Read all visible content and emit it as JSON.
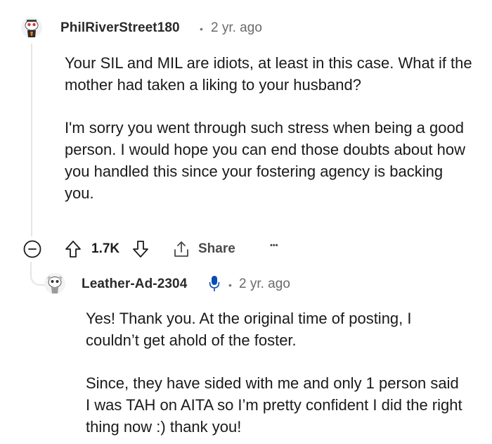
{
  "comment": {
    "username": "PhilRiverStreet180",
    "separator": "•",
    "age": "2 yr. ago",
    "paragraphs": [
      "Your SIL and MIL are idiots, at least in this case. What if the mother had taken a liking to your husband?",
      "I'm sorry you went through such stress when being a good person. I would hope you can end those doubts about how you handled this since your fostering agency is backing you."
    ],
    "actions": {
      "vote_count": "1.7K",
      "share_label": "Share",
      "more_label": "•••"
    }
  },
  "reply": {
    "username": "Leather-Ad-2304",
    "separator": "•",
    "age": "2 yr. ago",
    "paragraphs": [
      "Yes! Thank you. At the original time of posting, I couldn’t get ahold of the foster.",
      "Since, they have sided with me and only 1 person said I was TAH on AITA so I’m pretty confident I did the right thing now :) thank you!"
    ]
  },
  "colors": {
    "text": "#1a1a1a",
    "meta": "#6a6a6a",
    "thread_line": "#e5e5e5",
    "verified_mic": "#0a4bb5"
  },
  "icons": {
    "collapse": "minus-circle-icon",
    "upvote": "arrow-up-icon",
    "downvote": "arrow-down-icon",
    "share": "share-icon",
    "more": "ellipsis-icon",
    "badge": "microphone-icon"
  }
}
